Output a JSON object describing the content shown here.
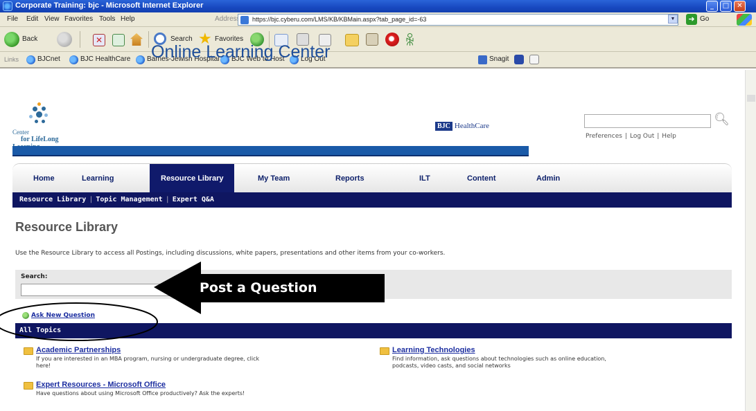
{
  "window": {
    "title": "Corporate Training: bjc - Microsoft Internet Explorer"
  },
  "menubar": {
    "items": [
      "File",
      "Edit",
      "View",
      "Favorites",
      "Tools",
      "Help"
    ],
    "address_label": "Address",
    "url": "https://bjc.cyberu.com/LMS/KB/KBMain.aspx?tab_page_id=-63",
    "go_label": "Go"
  },
  "toolbar": {
    "back_label": "Back",
    "search_label": "Search",
    "favorites_label": "Favorites"
  },
  "linksbar": {
    "label": "Links",
    "links": [
      "BJCnet",
      "BJC HealthCare",
      "Barnes-Jewish Hospital",
      "BJC Web to Host",
      "Log Out"
    ],
    "snagit_label": "Snagit"
  },
  "header": {
    "logo_line1": "Center",
    "logo_line2": "for LifeLong",
    "logo_line3": "Learning",
    "site_title": "Online Learning Center",
    "brand_box": "BJC",
    "brand_text": "HealthCare",
    "top_links": [
      "Preferences",
      "Log Out",
      "Help"
    ]
  },
  "nav": {
    "tabs": [
      "Home",
      "Learning",
      "Resource Library",
      "My Team",
      "Reports",
      "ILT",
      "Content",
      "Admin"
    ],
    "active": "Resource Library",
    "subnav": [
      "Resource Library",
      "Topic Management",
      "Expert Q&A"
    ]
  },
  "main": {
    "heading": "Resource Library",
    "description": "Use the Resource Library to access all Postings, including discussions, white papers, presentations and other items from your co-workers.",
    "search_label": "Search:",
    "ask_link": "Ask New Question",
    "all_topics": "All Topics",
    "topics": [
      {
        "title": "Academic Partnerships",
        "desc_line1": "If you are interested in an MBA program, nursing or undergraduate degree, click",
        "desc_line2": "here!"
      },
      {
        "title": "Learning Technologies",
        "desc_line1": "Find information, ask questions about technologies such as online education,",
        "desc_line2": "podcasts, video casts, and social networks"
      },
      {
        "title": "Expert Resources - Microsoft Office",
        "desc_line1": "Have questions about using Microsoft Office productively? Ask the experts!",
        "desc_line2": ""
      }
    ]
  },
  "callout": {
    "text": "Post a Question"
  }
}
